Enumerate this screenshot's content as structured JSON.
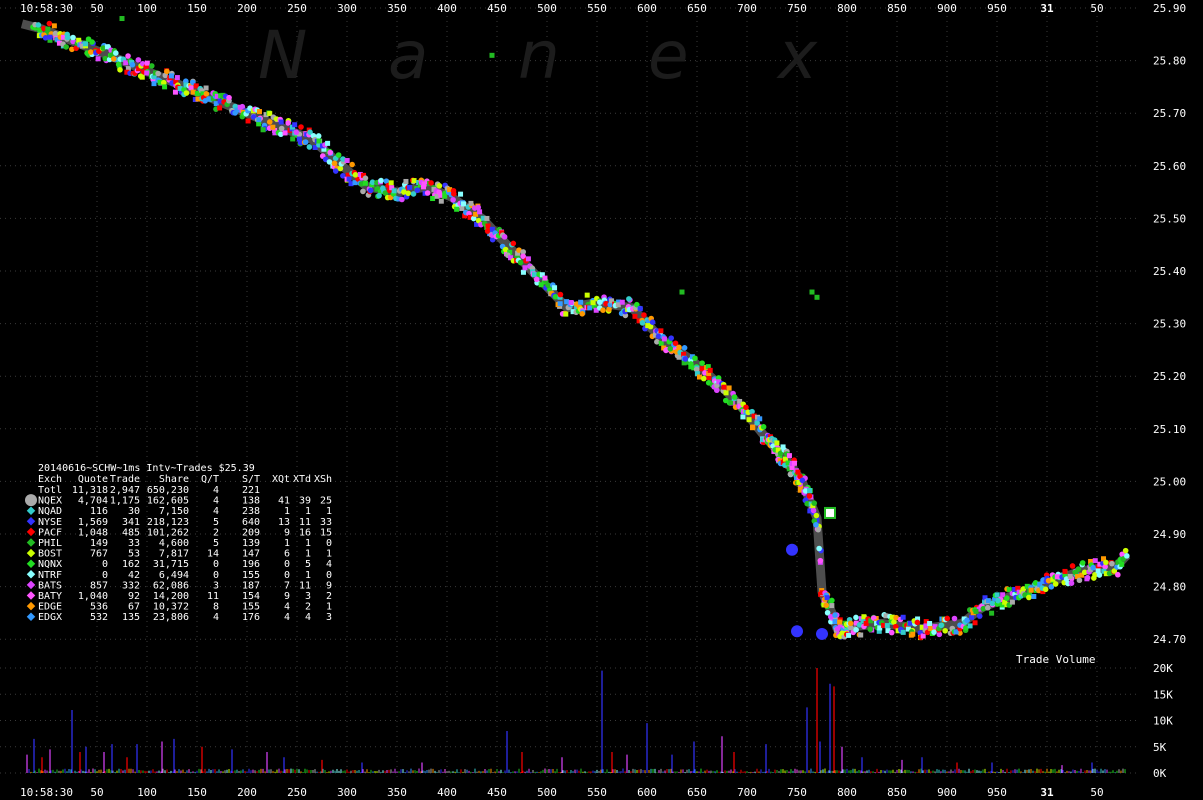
{
  "watermark": [
    "N",
    "a",
    "n",
    "e",
    "x"
  ],
  "colors": {
    "background": "#000000",
    "grid": "#3a3a3a",
    "nbbo_band": "#555555",
    "text": "#ffffff",
    "NQEX": "#aaaaaa",
    "NQAD": "#33cccc",
    "NYSE": "#3333ff",
    "PACF": "#ff0000",
    "PHIL": "#22bb22",
    "BOST": "#ccff00",
    "NQNX": "#22dd22",
    "NTRF": "#88ffff",
    "BATS": "#dd44ff",
    "BATY": "#ff55ff",
    "EDGE": "#ff9900",
    "EDGX": "#3399ff"
  },
  "chart_data": [
    {
      "type": "scatter",
      "title": "20140616~SCHW~1ms Intv~Trades $25.39",
      "x_start_label": "10:58:30",
      "x_ticks": [
        "50",
        "100",
        "150",
        "200",
        "250",
        "300",
        "350",
        "400",
        "450",
        "500",
        "550",
        "600",
        "650",
        "700",
        "750",
        "800",
        "850",
        "900",
        "950",
        "31",
        "50"
      ],
      "x_bold_tick": "31",
      "xlim_ms": [
        0,
        1110
      ],
      "y_ticks": [
        "25.90",
        "25.80",
        "25.70",
        "25.60",
        "25.50",
        "25.40",
        "25.30",
        "25.20",
        "25.10",
        "25.00",
        "24.90",
        "24.80",
        "24.70"
      ],
      "ylim": [
        24.7,
        25.9
      ],
      "grid": true,
      "legend_placement": "left-middle",
      "price_path": [
        [
          0,
          25.87
        ],
        [
          20,
          25.86
        ],
        [
          60,
          25.83
        ],
        [
          100,
          25.8
        ],
        [
          150,
          25.76
        ],
        [
          200,
          25.72
        ],
        [
          250,
          25.68
        ],
        [
          290,
          25.65
        ],
        [
          320,
          25.6
        ],
        [
          345,
          25.56
        ],
        [
          375,
          25.55
        ],
        [
          405,
          25.56
        ],
        [
          430,
          25.54
        ],
        [
          460,
          25.5
        ],
        [
          490,
          25.44
        ],
        [
          520,
          25.38
        ],
        [
          545,
          25.33
        ],
        [
          575,
          25.34
        ],
        [
          610,
          25.33
        ],
        [
          640,
          25.27
        ],
        [
          670,
          25.23
        ],
        [
          700,
          25.18
        ],
        [
          720,
          25.14
        ],
        [
          745,
          25.08
        ],
        [
          765,
          25.04
        ],
        [
          780,
          25.0
        ],
        [
          795,
          24.93
        ],
        [
          800,
          24.79
        ],
        [
          810,
          24.75
        ],
        [
          815,
          24.72
        ],
        [
          860,
          24.73
        ],
        [
          900,
          24.72
        ],
        [
          940,
          24.73
        ],
        [
          960,
          24.76
        ],
        [
          1000,
          24.79
        ],
        [
          1030,
          24.81
        ],
        [
          1060,
          24.83
        ],
        [
          1095,
          24.84
        ],
        [
          1105,
          24.86
        ]
      ],
      "legend": {
        "headers": [
          "Exch",
          "Quote",
          "Trade",
          "Share",
          "Q/T",
          "S/T",
          "XQt",
          "XTd",
          "XSh"
        ],
        "rows": [
          {
            "exch": "Totl",
            "quote": "11,318",
            "trade": "2,947",
            "share": "650,230",
            "qt": "4",
            "st": "221",
            "xqt": "",
            "xtd": "",
            "xsh": "",
            "color": ""
          },
          {
            "exch": "NQEX",
            "quote": "4,704",
            "trade": "1,175",
            "share": "162,605",
            "qt": "4",
            "st": "138",
            "xqt": "41",
            "xtd": "39",
            "xsh": "25",
            "color": "#aaaaaa"
          },
          {
            "exch": "NQAD",
            "quote": "116",
            "trade": "30",
            "share": "7,150",
            "qt": "4",
            "st": "238",
            "xqt": "1",
            "xtd": "1",
            "xsh": "1",
            "color": "#33cccc"
          },
          {
            "exch": "NYSE",
            "quote": "1,569",
            "trade": "341",
            "share": "218,123",
            "qt": "5",
            "st": "640",
            "xqt": "13",
            "xtd": "11",
            "xsh": "33",
            "color": "#3333ff"
          },
          {
            "exch": "PACF",
            "quote": "1,048",
            "trade": "485",
            "share": "101,262",
            "qt": "2",
            "st": "209",
            "xqt": "9",
            "xtd": "16",
            "xsh": "15",
            "color": "#ff0000"
          },
          {
            "exch": "PHIL",
            "quote": "149",
            "trade": "33",
            "share": "4,600",
            "qt": "5",
            "st": "139",
            "xqt": "1",
            "xtd": "1",
            "xsh": "0",
            "color": "#22bb22"
          },
          {
            "exch": "BOST",
            "quote": "767",
            "trade": "53",
            "share": "7,817",
            "qt": "14",
            "st": "147",
            "xqt": "6",
            "xtd": "1",
            "xsh": "1",
            "color": "#ccff00"
          },
          {
            "exch": "NQNX",
            "quote": "0",
            "trade": "162",
            "share": "31,715",
            "qt": "0",
            "st": "196",
            "xqt": "0",
            "xtd": "5",
            "xsh": "4",
            "color": "#22dd22"
          },
          {
            "exch": "NTRF",
            "quote": "0",
            "trade": "42",
            "share": "6,494",
            "qt": "0",
            "st": "155",
            "xqt": "0",
            "xtd": "1",
            "xsh": "0",
            "color": "#88ffff"
          },
          {
            "exch": "BATS",
            "quote": "857",
            "trade": "332",
            "share": "62,086",
            "qt": "3",
            "st": "187",
            "xqt": "7",
            "xtd": "11",
            "xsh": "9",
            "color": "#dd44ff"
          },
          {
            "exch": "BATY",
            "quote": "1,040",
            "trade": "92",
            "share": "14,200",
            "qt": "11",
            "st": "154",
            "xqt": "9",
            "xtd": "3",
            "xsh": "2",
            "color": "#ff55ff"
          },
          {
            "exch": "EDGE",
            "quote": "536",
            "trade": "67",
            "share": "10,372",
            "qt": "8",
            "st": "155",
            "xqt": "4",
            "xtd": "2",
            "xsh": "1",
            "color": "#ff9900"
          },
          {
            "exch": "EDGX",
            "quote": "532",
            "trade": "135",
            "share": "23,806",
            "qt": "4",
            "st": "176",
            "xqt": "4",
            "xtd": "4",
            "xsh": "3",
            "color": "#3399ff"
          }
        ]
      }
    },
    {
      "type": "bar",
      "title": "Trade Volume",
      "y_ticks": [
        "20K",
        "15K",
        "10K",
        "5K",
        "0K"
      ],
      "ylim": [
        0,
        20000
      ],
      "grid": true,
      "spikes": [
        {
          "x": 5,
          "v": 3500,
          "c": "#dd44ff"
        },
        {
          "x": 12,
          "v": 6500,
          "c": "#3333ff"
        },
        {
          "x": 20,
          "v": 3000,
          "c": "#ff0000"
        },
        {
          "x": 28,
          "v": 4500,
          "c": "#dd44ff"
        },
        {
          "x": 50,
          "v": 12000,
          "c": "#3333ff"
        },
        {
          "x": 58,
          "v": 4000,
          "c": "#ff0000"
        },
        {
          "x": 64,
          "v": 5000,
          "c": "#3333ff"
        },
        {
          "x": 82,
          "v": 4000,
          "c": "#dd44ff"
        },
        {
          "x": 90,
          "v": 5500,
          "c": "#3333ff"
        },
        {
          "x": 105,
          "v": 3000,
          "c": "#ff0000"
        },
        {
          "x": 115,
          "v": 5500,
          "c": "#3333ff"
        },
        {
          "x": 140,
          "v": 6000,
          "c": "#dd44ff"
        },
        {
          "x": 152,
          "v": 6500,
          "c": "#3333ff"
        },
        {
          "x": 180,
          "v": 5000,
          "c": "#ff0000"
        },
        {
          "x": 210,
          "v": 4500,
          "c": "#3333ff"
        },
        {
          "x": 245,
          "v": 4000,
          "c": "#dd44ff"
        },
        {
          "x": 262,
          "v": 3000,
          "c": "#3333ff"
        },
        {
          "x": 300,
          "v": 2500,
          "c": "#ff0000"
        },
        {
          "x": 340,
          "v": 2000,
          "c": "#3333ff"
        },
        {
          "x": 400,
          "v": 2000,
          "c": "#dd44ff"
        },
        {
          "x": 485,
          "v": 8000,
          "c": "#3333ff"
        },
        {
          "x": 500,
          "v": 4000,
          "c": "#ff0000"
        },
        {
          "x": 540,
          "v": 3000,
          "c": "#dd44ff"
        },
        {
          "x": 580,
          "v": 19500,
          "c": "#3333ff"
        },
        {
          "x": 590,
          "v": 4000,
          "c": "#ff0000"
        },
        {
          "x": 605,
          "v": 3500,
          "c": "#dd44ff"
        },
        {
          "x": 625,
          "v": 9500,
          "c": "#3333ff"
        },
        {
          "x": 650,
          "v": 3500,
          "c": "#3333ff"
        },
        {
          "x": 672,
          "v": 6000,
          "c": "#3333ff"
        },
        {
          "x": 700,
          "v": 7000,
          "c": "#dd44ff"
        },
        {
          "x": 712,
          "v": 4000,
          "c": "#ff0000"
        },
        {
          "x": 744,
          "v": 5500,
          "c": "#3333ff"
        },
        {
          "x": 785,
          "v": 12500,
          "c": "#3333ff"
        },
        {
          "x": 795,
          "v": 20000,
          "c": "#ff0000"
        },
        {
          "x": 798,
          "v": 6000,
          "c": "#3333ff"
        },
        {
          "x": 808,
          "v": 17000,
          "c": "#3333ff"
        },
        {
          "x": 812,
          "v": 16500,
          "c": "#ff0000"
        },
        {
          "x": 820,
          "v": 5000,
          "c": "#dd44ff"
        },
        {
          "x": 840,
          "v": 3000,
          "c": "#3333ff"
        },
        {
          "x": 880,
          "v": 2500,
          "c": "#dd44ff"
        },
        {
          "x": 900,
          "v": 3000,
          "c": "#3333ff"
        },
        {
          "x": 935,
          "v": 2000,
          "c": "#ff0000"
        },
        {
          "x": 970,
          "v": 2000,
          "c": "#3333ff"
        },
        {
          "x": 1040,
          "v": 1500,
          "c": "#dd44ff"
        },
        {
          "x": 1070,
          "v": 2000,
          "c": "#3333ff"
        }
      ]
    }
  ]
}
